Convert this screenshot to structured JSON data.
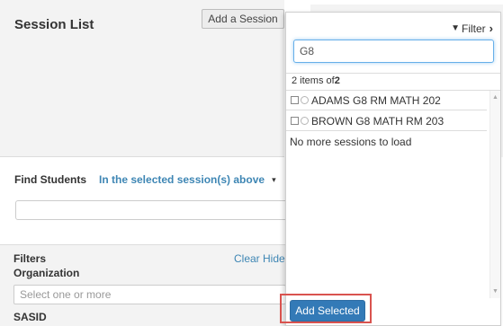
{
  "session_list": {
    "title": "Session List",
    "add_button": "Add a Session"
  },
  "find_students": {
    "label": "Find Students",
    "scope": "In the selected session(s) above",
    "caret": "▾",
    "input_value": ""
  },
  "filters": {
    "title": "Filters",
    "organization_label": "Organization",
    "clear": "Clear",
    "hide": "Hide",
    "org_placeholder": "Select one or more",
    "sasid_label": "SASID"
  },
  "dropdown": {
    "filter_label": "Filter",
    "search_value": "G8",
    "count_prefix": "2 items of",
    "count_total": "2",
    "items": [
      {
        "label": "ADAMS G8 RM MATH 202",
        "checked": false
      },
      {
        "label": "BROWN G8 MATH RM 203",
        "checked": false
      }
    ],
    "no_more": "No more sessions to load",
    "add_selected": "Add Selected"
  },
  "icons": {
    "filter": "funnel-icon",
    "chevron": "chevron-right-icon",
    "scroll_up": "caret-up-icon",
    "scroll_down": "caret-down-icon"
  },
  "colors": {
    "link": "#3e86b4",
    "primary_button": "#337ab7",
    "highlight": "#d9534f",
    "focus": "#66afe9"
  }
}
